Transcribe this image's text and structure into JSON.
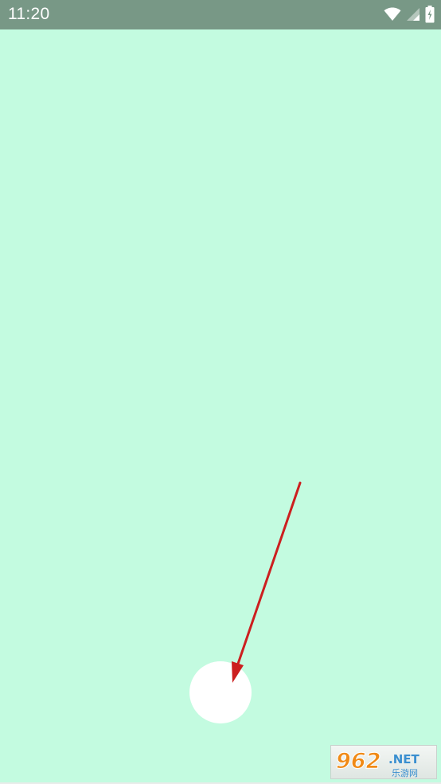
{
  "status_bar": {
    "time": "11:20",
    "icons": [
      "wifi-icon",
      "cell-signal-icon",
      "battery-charging-icon"
    ]
  },
  "screen": {
    "background_color": "#c3fbe0",
    "status_bar_color": "#789886"
  },
  "tap_indicator": {
    "color": "#ffffff"
  },
  "annotation_arrow": {
    "color": "#cc1f1f"
  },
  "watermark": {
    "brand": "962",
    "suffix": ".NET",
    "tagline": "乐游网"
  }
}
